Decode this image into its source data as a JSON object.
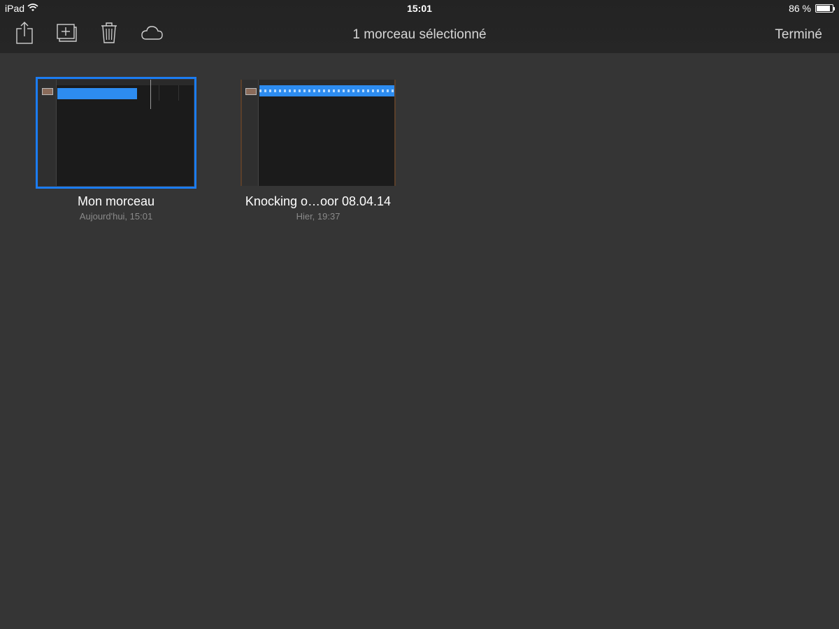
{
  "status_bar": {
    "device": "iPad",
    "time": "15:01",
    "battery_label": "86 %",
    "battery_level": 0.86
  },
  "toolbar": {
    "title": "1 morceau sélectionné",
    "done_label": "Terminé",
    "icons": [
      "share-icon",
      "duplicate-icon",
      "trash-icon",
      "cloud-icon"
    ]
  },
  "songs": [
    {
      "name": "Mon morceau",
      "date": "Aujourd'hui, 15:01",
      "selected": true
    },
    {
      "name": "Knocking o…oor 08.04.14",
      "date": "Hier, 19:37",
      "selected": false
    }
  ],
  "colors": {
    "background": "#353535",
    "toolbar": "#242424",
    "selection": "#1b7cf2",
    "region": "#2d8cf0"
  }
}
